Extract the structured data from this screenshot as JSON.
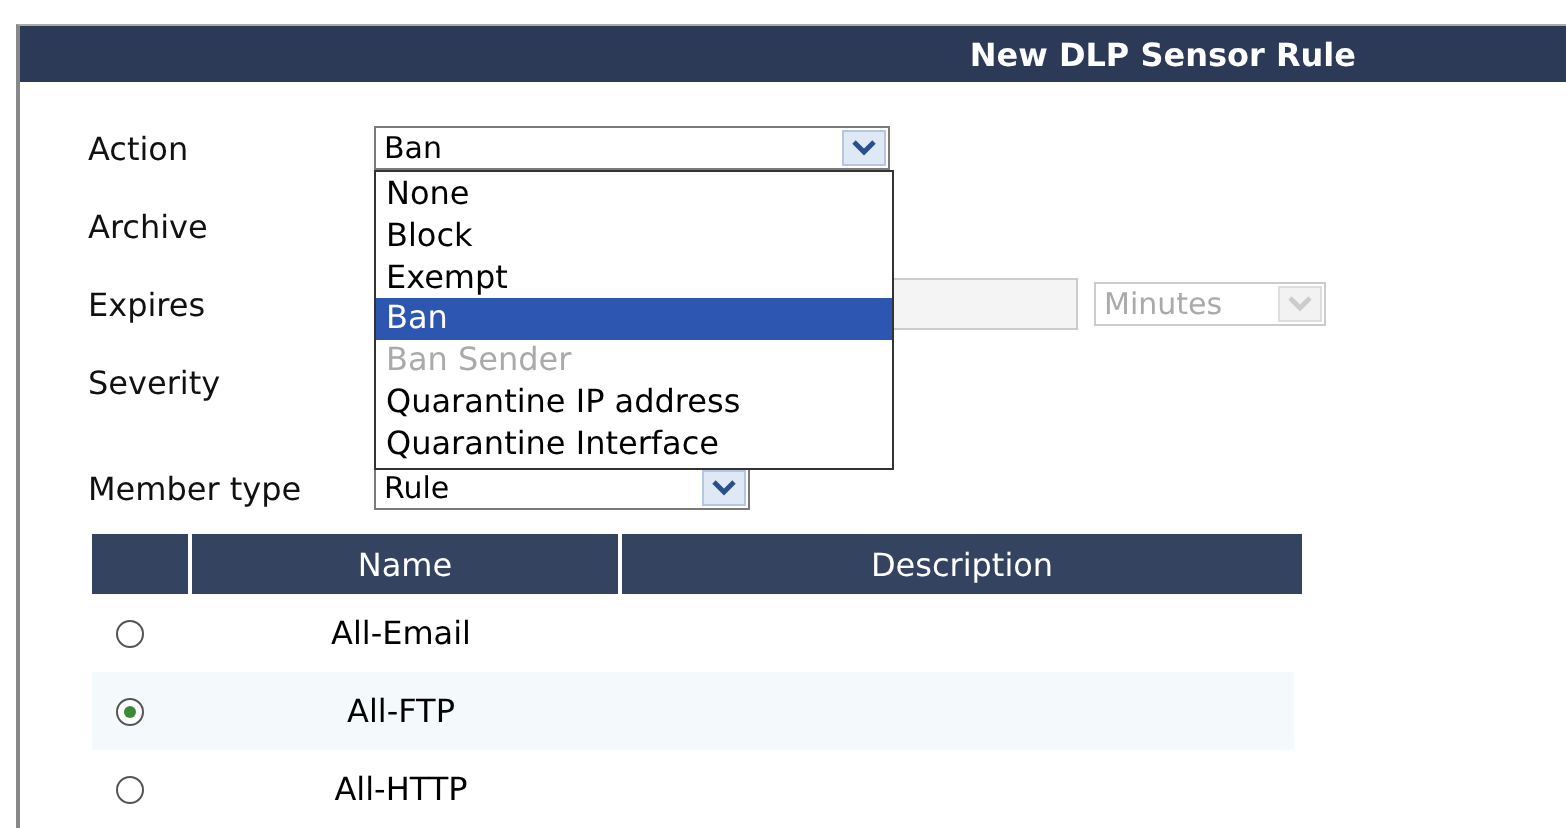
{
  "header": {
    "title": "New DLP Sensor Rule"
  },
  "fields": [
    {
      "kind": "dropdown",
      "label": "Action",
      "value": "Ban",
      "expanded": true,
      "options": [
        {
          "label": "None",
          "selected": false,
          "disabled": false
        },
        {
          "label": "Block",
          "selected": false,
          "disabled": false
        },
        {
          "label": "Exempt",
          "selected": false,
          "disabled": false
        },
        {
          "label": "Ban",
          "selected": true,
          "disabled": false
        },
        {
          "label": "Ban Sender",
          "selected": false,
          "disabled": true
        },
        {
          "label": "Quarantine IP address",
          "selected": false,
          "disabled": false
        },
        {
          "label": "Quarantine Interface",
          "selected": false,
          "disabled": false
        }
      ]
    },
    {
      "kind": "covered",
      "label": "Archive"
    },
    {
      "kind": "duration",
      "label": "Expires",
      "unit": "Minutes",
      "disabled": true
    },
    {
      "kind": "covered",
      "label": "Severity"
    },
    {
      "kind": "select",
      "label": "Member type",
      "value": "Rule"
    }
  ],
  "table": {
    "columns": [
      "Name",
      "Description"
    ],
    "rows": [
      {
        "name": "All-Email",
        "selected": false
      },
      {
        "name": "All-FTP",
        "selected": true
      },
      {
        "name": "All-HTTP",
        "selected": false
      }
    ]
  }
}
